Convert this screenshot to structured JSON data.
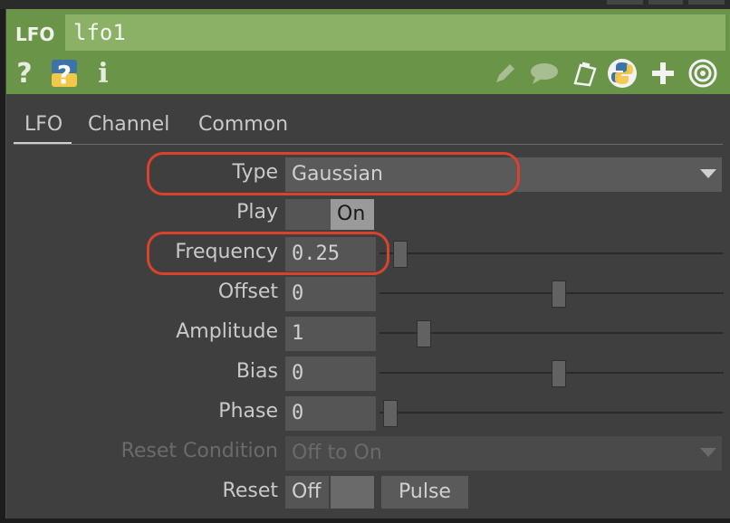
{
  "header": {
    "type_label": "LFO",
    "name_value": "lfo1",
    "icons": [
      "help-icon",
      "python-help-icon",
      "info-icon",
      "pencil-icon",
      "comment-icon",
      "clipboard-icon",
      "python-icon",
      "plus-icon",
      "target-icon"
    ],
    "color_header": "#6a9448",
    "color_name_field": "#8bb166"
  },
  "tabs": [
    "LFO",
    "Channel",
    "Common"
  ],
  "active_tab": "LFO",
  "params": {
    "type": {
      "label": "Type",
      "value": "Gaussian"
    },
    "play": {
      "label": "Play",
      "value": "On"
    },
    "frequency": {
      "label": "Frequency",
      "value": "0.25",
      "slider_fraction": 0.03
    },
    "offset": {
      "label": "Offset",
      "value": "0",
      "slider_fraction": 0.5
    },
    "amplitude": {
      "label": "Amplitude",
      "value": "1",
      "slider_fraction": 0.1
    },
    "bias": {
      "label": "Bias",
      "value": "0",
      "slider_fraction": 0.5
    },
    "phase": {
      "label": "Phase",
      "value": "0",
      "slider_fraction": 0.0
    },
    "reset_condition": {
      "label": "Reset Condition",
      "value": "Off to On",
      "disabled": true
    },
    "reset": {
      "label": "Reset",
      "value": "Off",
      "pulse_label": "Pulse"
    }
  },
  "highlight_color": "#d9432b"
}
